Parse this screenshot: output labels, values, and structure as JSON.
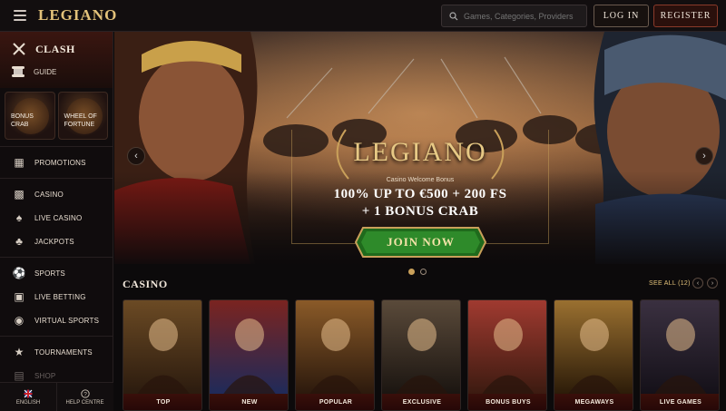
{
  "header": {
    "brand": "LEGIANO",
    "search_placeholder": "Games, Categories, Providers",
    "login_label": "LOG IN",
    "register_label": "REGISTER"
  },
  "sidebar": {
    "clash_label": "CLASH",
    "guide_label": "GUIDE",
    "tiles": [
      {
        "label1": "BONUS",
        "label2": "CRAB"
      },
      {
        "label1": "WHEEL OF",
        "label2": "FORTUNE"
      }
    ],
    "groups": [
      [
        {
          "label": "PROMOTIONS",
          "icon": "gift-icon"
        }
      ],
      [
        {
          "label": "CASINO",
          "icon": "slot-machine-icon"
        },
        {
          "label": "LIVE CASINO",
          "icon": "cards-icon"
        },
        {
          "label": "JACKPOTS",
          "icon": "clover-icon"
        }
      ],
      [
        {
          "label": "SPORTS",
          "icon": "ball-icon"
        },
        {
          "label": "LIVE BETTING",
          "icon": "tv-icon"
        },
        {
          "label": "VIRTUAL SPORTS",
          "icon": "gamepad-icon"
        }
      ],
      [
        {
          "label": "TOURNAMENTS",
          "icon": "trophy-icon"
        },
        {
          "label": "SHOP",
          "icon": "shop-icon"
        }
      ]
    ],
    "language_label": "ENGLISH",
    "help_label": "HELP CENTRE"
  },
  "banner": {
    "logo": "LEGIANO",
    "subtitle": "Casino Welcome Bonus",
    "line1": "100% UP TO €500 + 200 FS",
    "line2": "+ 1 BONUS CRAB",
    "cta": "JOIN NOW",
    "slide_count": 2,
    "active_slide": 1
  },
  "casino": {
    "title": "CASINO",
    "see_all": "SEE ALL (12)",
    "cards": [
      {
        "label": "TOP",
        "c1": "#6b4a24",
        "c2": "#2a1a0e"
      },
      {
        "label": "NEW",
        "c1": "#7a2420",
        "c2": "#1e2a5a"
      },
      {
        "label": "POPULAR",
        "c1": "#8a5a28",
        "c2": "#2a180c"
      },
      {
        "label": "EXCLUSIVE",
        "c1": "#5a4a3a",
        "c2": "#1a1410"
      },
      {
        "label": "BONUS BUYS",
        "c1": "#a03a30",
        "c2": "#3a1a10"
      },
      {
        "label": "MEGAWAYS",
        "c1": "#9a7030",
        "c2": "#2a1a08"
      },
      {
        "label": "LIVE GAMES",
        "c1": "#3a3040",
        "c2": "#141018"
      }
    ]
  },
  "colors": {
    "gold": "#e3c27a",
    "dark": "#0c0a0b",
    "accent_red": "#8a3a2a",
    "cta_green": "#2e8a2a"
  }
}
